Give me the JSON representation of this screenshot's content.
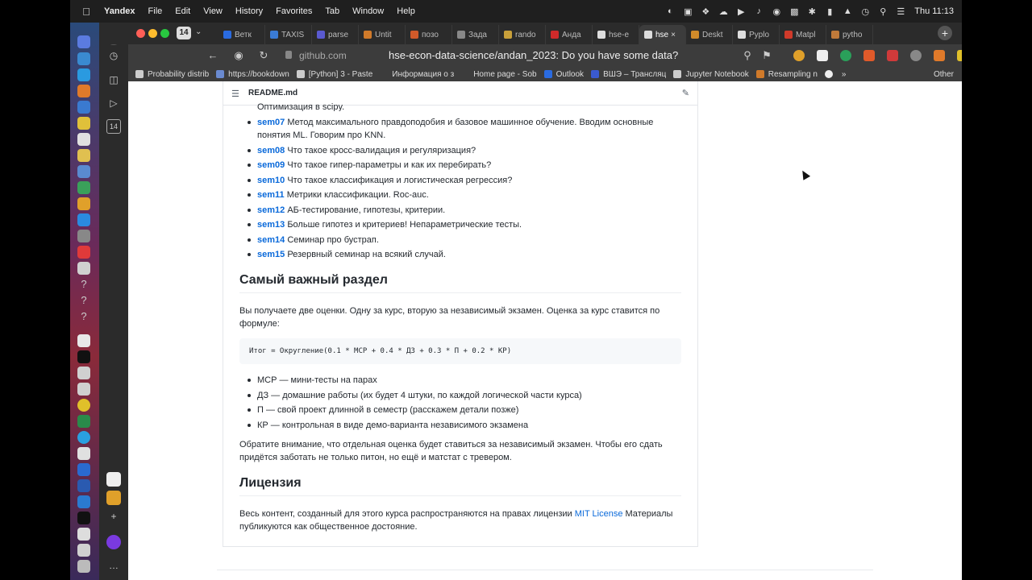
{
  "menubar": {
    "app_name": "Yandex",
    "items": [
      "File",
      "Edit",
      "View",
      "History",
      "Favorites",
      "Tab",
      "Window",
      "Help"
    ],
    "clock": "Thu  11:13"
  },
  "browser": {
    "tab_count_badge": "14",
    "tabs": [
      {
        "label": "Ветк",
        "color": "#2a6be0"
      },
      {
        "label": "TAXIS",
        "color": "#3a7bd5"
      },
      {
        "label": "parse",
        "color": "#5a5ad0"
      },
      {
        "label": "Untit",
        "color": "#d07a2a"
      },
      {
        "label": "позо",
        "color": "#d05a2a"
      },
      {
        "label": "Зада",
        "color": "#888888"
      },
      {
        "label": "rando",
        "color": "#c8a03a"
      },
      {
        "label": "Анда",
        "color": "#d02a2a"
      },
      {
        "label": "hse-e",
        "color": "#dddddd"
      },
      {
        "label": "hse",
        "color": "#dddddd",
        "active": true
      },
      {
        "label": "Deskt",
        "color": "#d08a2a"
      },
      {
        "label": "Pyplo",
        "color": "#dddddd"
      },
      {
        "label": "Matpl",
        "color": "#d03a2a"
      },
      {
        "label": "pytho",
        "color": "#c07a3a"
      }
    ],
    "address_domain": "github.com",
    "page_title": "hse-econ-data-science/andan_2023: Do you have some data?",
    "sidebar_badge": "14",
    "bookmarks": [
      {
        "label": "Probability distrib",
        "color": "#cccccc"
      },
      {
        "label": "https://bookdown",
        "color": "#6a8ad0"
      },
      {
        "label": "[Python] 3 - Paste",
        "color": "#cccccc"
      },
      {
        "label": "Информация о з",
        "color": "#3c3c3c"
      },
      {
        "label": "Home page - Sob",
        "color": "#3c3c3c"
      },
      {
        "label": "Outlook",
        "color": "#2a6be0"
      },
      {
        "label": "ВШЭ – Трансляц",
        "color": "#3a5ad0"
      },
      {
        "label": "Jupyter Notebook",
        "color": "#cccccc"
      },
      {
        "label": "Resampling n",
        "color": "#d07a2a"
      }
    ],
    "bookmarks_other": "Other"
  },
  "readme": {
    "filename": "README.md",
    "cut_line": "Оптимизация в scipy.",
    "seminars": [
      {
        "code": "sem07",
        "text": "Метод максимального правдоподобия и базовое машинное обучение. Вводим основные понятия ML. Говорим про KNN."
      },
      {
        "code": "sem08",
        "text": "Что такое кросс-валидация и регуляризация?"
      },
      {
        "code": "sem09",
        "text": "Что такое гипер-параметры и как их перебирать?"
      },
      {
        "code": "sem10",
        "text": "Что такое классификация и логистическая регрессия?"
      },
      {
        "code": "sem11",
        "text": "Метрики классификации. Roc-auc."
      },
      {
        "code": "sem12",
        "text": "АБ-тестирование, гипотезы, критерии."
      },
      {
        "code": "sem13",
        "text": "Больше гипотез и критериев! Непараметрические тесты."
      },
      {
        "code": "sem14",
        "text": "Семинар про бустрап."
      },
      {
        "code": "sem15",
        "text": "Резервный семинар на всякий случай."
      }
    ],
    "section_title": "Самый важный раздел",
    "grading_intro": "Вы получаете две оценки. Одну за курс, вторую за независимый экзамен. Оценка за курс ставится по формуле:",
    "formula": "Итог = Округление(0.1 * МСР + 0.4 * ДЗ + 0.3 * П + 0.2 * КР)",
    "components": [
      "МСР — мини-тесты на парах",
      "ДЗ — домашние работы (их будет 4 штуки, по каждой логической части курса)",
      "П — свой проект длинной в семестр (расскажем детали позже)",
      "КР — контрольная в виде демо-варианта независимого экзамена"
    ],
    "exam_note": "Обратите внимание, что отдельная оценка будет ставиться за независимый экзамен. Чтобы его сдать придётся заботать не только питон, но ещё и матстат с тревером.",
    "license_title": "Лицензия",
    "license_before": "Весь контент, созданный для этого курса распространяются на правах лицензии ",
    "license_link": "MIT License",
    "license_after": " Материалы публикуются как общественное достояние."
  }
}
